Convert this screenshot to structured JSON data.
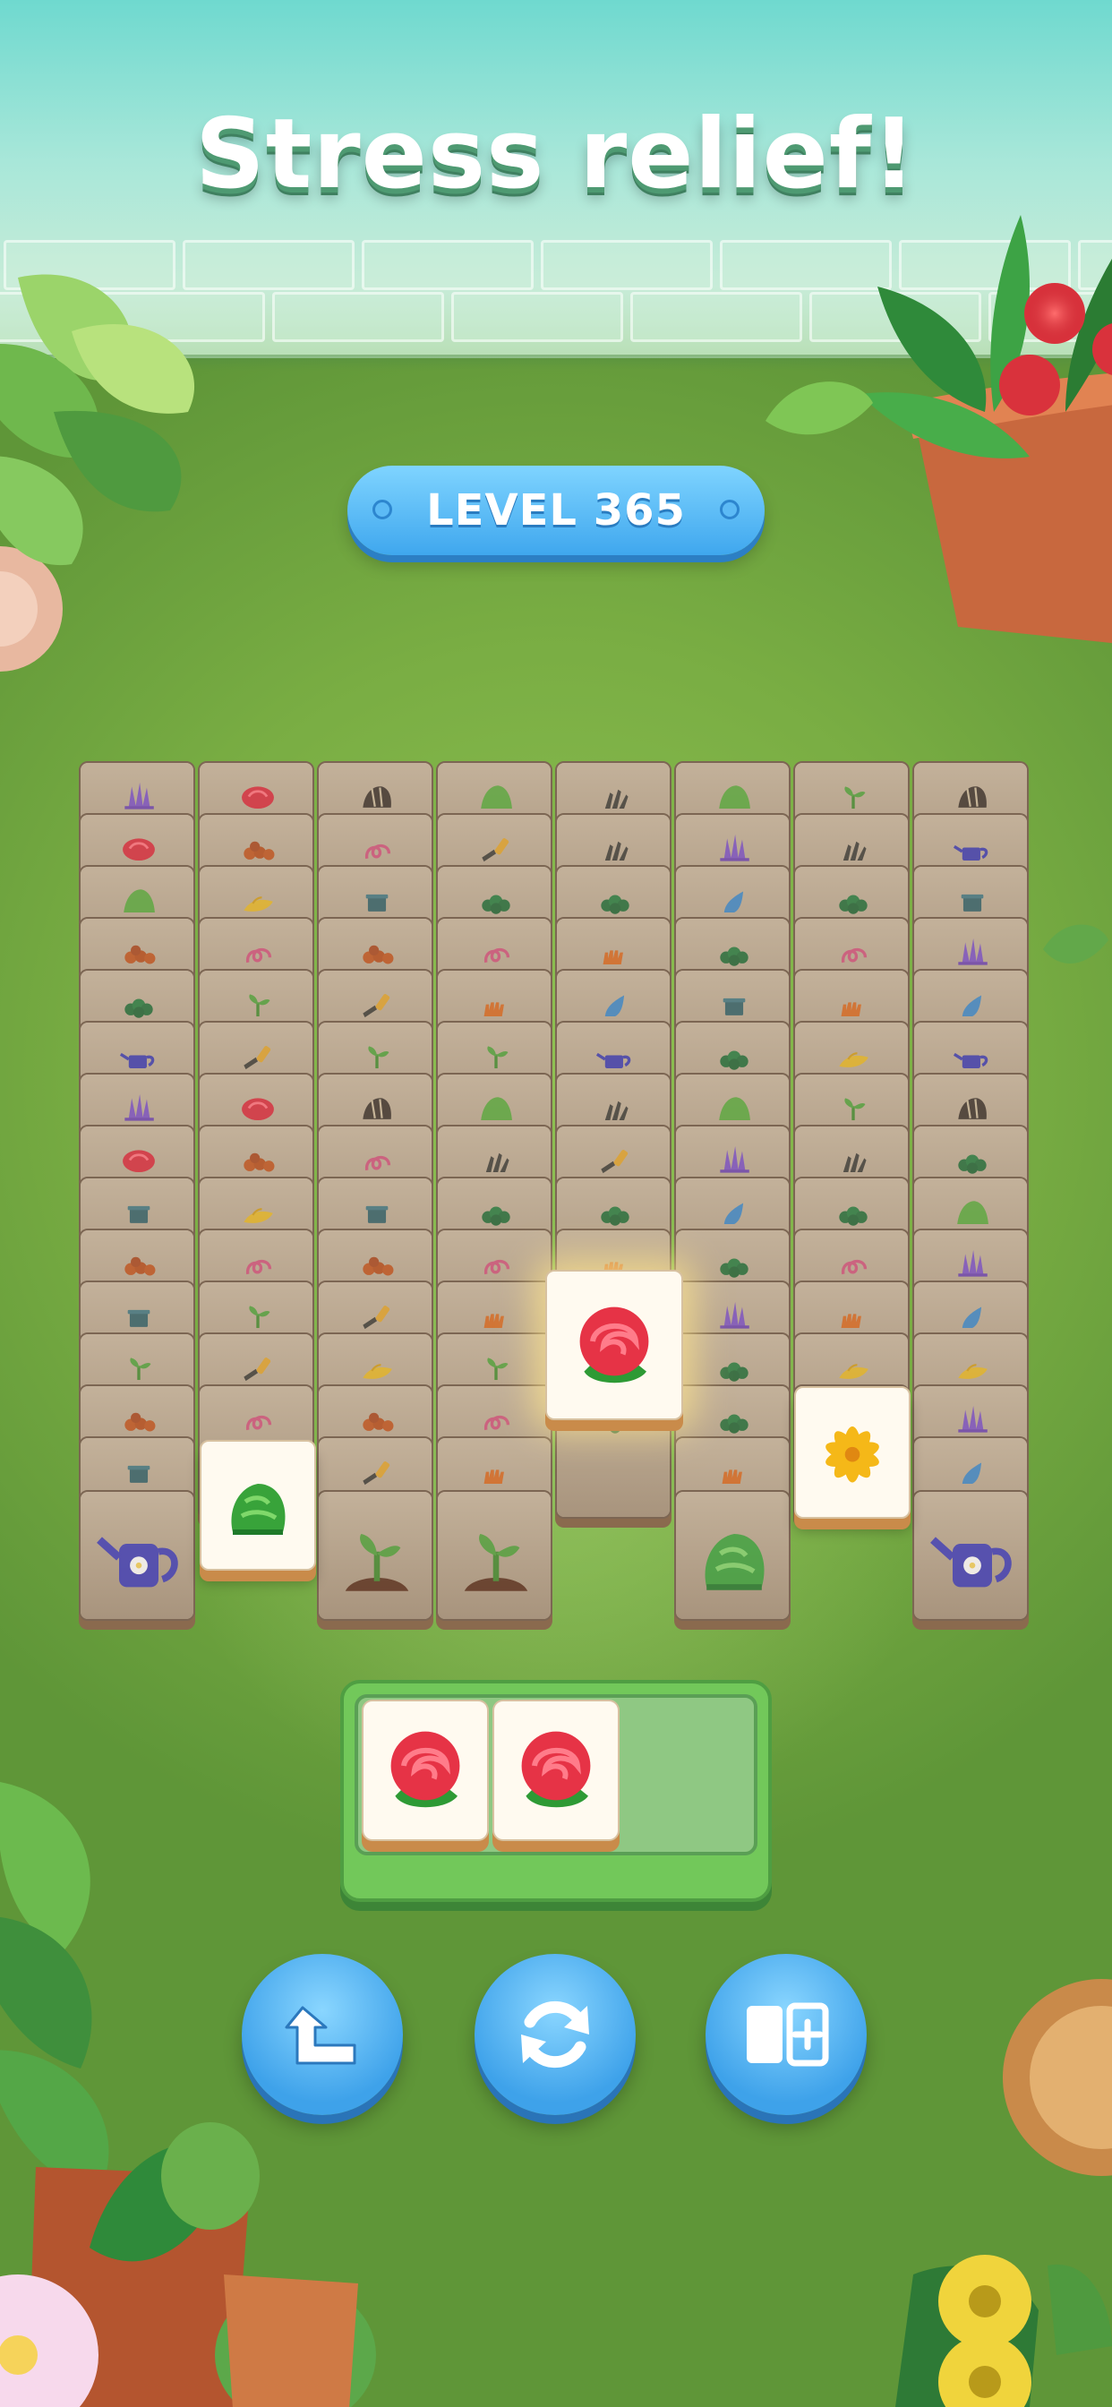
{
  "banner": {
    "title": "Stress relief!"
  },
  "level": {
    "label": "LEVEL 365"
  },
  "colors": {
    "wall": "#a8e7d9",
    "grass": "#79ad43",
    "tile_face": "#fffaf0",
    "tile_dim": "#b8a48c",
    "button_blue": "#3fa7ee",
    "tray_green": "#72c85a"
  },
  "board": {
    "columns": 8,
    "background_rows": [
      [
        "lavender",
        "rose",
        "seed",
        "bush",
        "rake",
        "bush",
        "sprout",
        "seed"
      ],
      [
        "rose",
        "acorns",
        "hose",
        "shovel",
        "rake",
        "lavender",
        "rake",
        "watering-can"
      ],
      [
        "bush",
        "leaf",
        "pot",
        "shrub",
        "shrub",
        "droplet",
        "shrub",
        "pot"
      ],
      [
        "acorns",
        "hose",
        "acorns",
        "hose",
        "gloves",
        "shrub",
        "hose",
        "lavender"
      ],
      [
        "shrub",
        "sprout",
        "shovel",
        "gloves",
        "droplet",
        "pot",
        "gloves",
        "droplet"
      ],
      [
        "watering-can",
        "shovel",
        "sprout",
        "sprout",
        "watering-can",
        "shrub",
        "leaf",
        "watering-can"
      ],
      [
        "lavender",
        "rose",
        "seed",
        "bush",
        "rake",
        "bush",
        "sprout",
        "seed"
      ],
      [
        "rose",
        "acorns",
        "hose",
        "rake",
        "shovel",
        "lavender",
        "rake",
        "shrub"
      ],
      [
        "pot",
        "leaf",
        "pot",
        "shrub",
        "shrub",
        "droplet",
        "shrub",
        "bush"
      ],
      [
        "acorns",
        "hose",
        "acorns",
        "hose",
        "gloves",
        "shrub",
        "hose",
        "lavender"
      ],
      [
        "pot",
        "sprout",
        "shovel",
        "gloves",
        "gloves",
        "lavender",
        "gloves",
        "droplet"
      ],
      [
        "sprout",
        "shovel",
        "leaf",
        "sprout",
        "shrub",
        "shrub",
        "leaf",
        "leaf"
      ],
      [
        "acorns",
        "hose",
        "acorns",
        "hose",
        "shrub",
        "shrub",
        "leaf",
        "lavender"
      ],
      [
        "pot",
        "",
        "shovel",
        "gloves",
        "",
        "gloves",
        "",
        "droplet"
      ]
    ],
    "bottom_row": [
      "watering-can",
      "",
      "sprout-pot",
      "sprout-pot",
      "",
      "shrub",
      "",
      "watering-can"
    ],
    "active_tiles": [
      {
        "item": "rose",
        "state": "selected"
      },
      {
        "item": "green-shrub",
        "state": "free"
      },
      {
        "item": "yellow-lily",
        "state": "free"
      }
    ]
  },
  "tray": {
    "capacity": 3,
    "slots": [
      {
        "item": "rose"
      },
      {
        "item": "rose"
      },
      {
        "item": ""
      }
    ]
  },
  "controls": [
    {
      "name": "undo",
      "icon": "undo-arrow-icon"
    },
    {
      "name": "shuffle",
      "icon": "shuffle-icon"
    },
    {
      "name": "extra-slot",
      "icon": "add-slot-icon"
    }
  ]
}
